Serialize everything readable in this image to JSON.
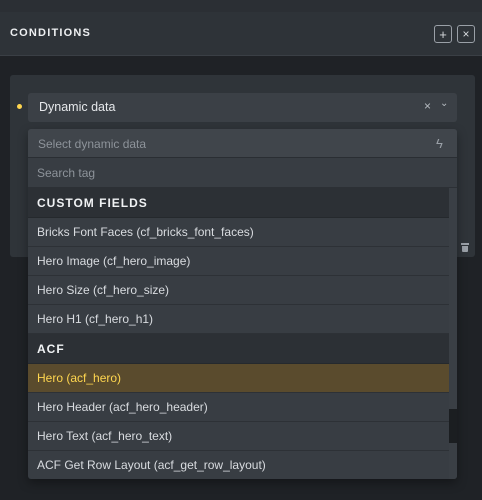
{
  "header": {
    "title": "CONDITIONS"
  },
  "condition": {
    "selected_value": "Dynamic data"
  },
  "dropdown": {
    "placeholder": "Select dynamic data",
    "search_placeholder": "Search tag",
    "groups": [
      {
        "label": "CUSTOM FIELDS",
        "items": [
          "Bricks Font Faces (cf_bricks_font_faces)",
          "Hero Image (cf_hero_image)",
          "Hero Size (cf_hero_size)",
          "Hero H1 (cf_hero_h1)"
        ]
      },
      {
        "label": "ACF",
        "items": [
          "Hero (acf_hero)",
          "Hero Header (acf_hero_header)",
          "Hero Text (acf_hero_text)",
          "ACF Get Row Layout (acf_get_row_layout)"
        ]
      }
    ],
    "active_item": "Hero (acf_hero)"
  },
  "colors": {
    "accent": "#ffd64f",
    "active_bg": "#5a4b2d"
  },
  "icons": [
    "plus-icon",
    "close-icon",
    "clear-icon",
    "chevron-down-icon",
    "bolt-icon",
    "trash-icon"
  ]
}
